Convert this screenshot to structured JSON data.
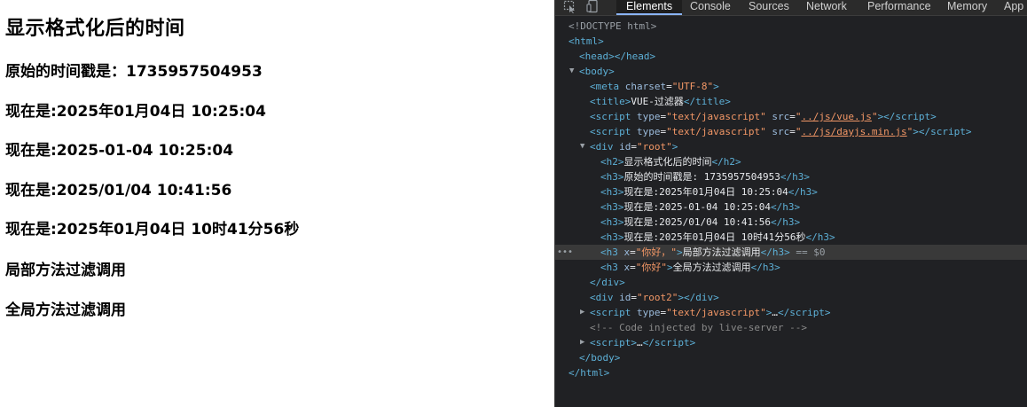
{
  "page": {
    "heading": "显示格式化后的时间",
    "lines": [
      "原始的时间戳是：1735957504953",
      "现在是:2025年01月04日 10:25:04",
      "现在是:2025-01-04 10:25:04",
      "现在是:2025/01/04 10:41:56",
      "现在是:2025年01月04日 10时41分56秒",
      "局部方法过滤调用",
      "全局方法过滤调用"
    ]
  },
  "devtools": {
    "toolbar_icons": [
      "inspect-element-icon",
      "device-toolbar-icon"
    ],
    "tabs": [
      "Elements",
      "Console",
      "Sources",
      "Network",
      "Performance",
      "Memory",
      "App"
    ],
    "active_tab": "Elements",
    "tree": {
      "doctype": "<!DOCTYPE html>",
      "html_open": "<html>",
      "head": "<head></head>",
      "body_open": "<body>",
      "meta_charset": "UTF-8",
      "title_text": "VUE-过滤器",
      "script_type": "text/javascript",
      "script_src_vue": "../js/vue.js",
      "script_src_dayjs": "../js/dayjs.min.js",
      "div_root_id": "root",
      "h2_text": "显示格式化后的时间",
      "h3_texts": [
        "原始的时间戳是: 1735957504953",
        "现在是:2025年01月04日 10:25:04",
        "现在是:2025-01-04 10:25:04",
        "现在是:2025/01/04 10:41:56",
        "现在是:2025年01月04日 10时41分56秒"
      ],
      "h3_x_value_1": "你好，",
      "h3_text_local": "局部方法过滤调用",
      "selected_marker": "== $0",
      "h3_x_value_2": "你好",
      "h3_text_global": "全局方法过滤调用",
      "div_root2_id": "root2",
      "ellipsis": "…",
      "comment": "<!-- Code injected by live-server -->",
      "body_close": "</body>",
      "html_close": "</html>"
    }
  },
  "colors": {
    "devtools_bg": "#202124",
    "tag": "#5db0d7",
    "attr_name": "#9bbbdc",
    "attr_value": "#f29766",
    "selected_row": "#393939",
    "active_tab_underline": "#8ab4f8"
  }
}
